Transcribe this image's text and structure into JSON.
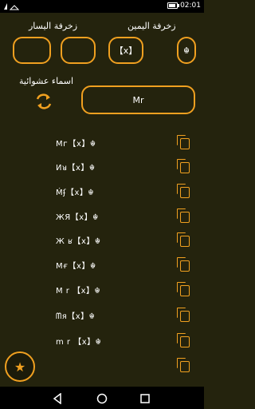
{
  "status": {
    "left_icons": "signal-wifi",
    "battery": "",
    "time": "02:01",
    "battery_level": 0.9
  },
  "header": {
    "right_label": "زخرفة اليمين",
    "left_label": "زخرفة اليسار"
  },
  "decoration_boxes": {
    "right_1": "☬",
    "right_2": "【x】",
    "left_1": "",
    "left_2": ""
  },
  "random_names_label": "اسماء عشوائية",
  "input": {
    "value": "Mr"
  },
  "rows": [
    {
      "text": "Mᴦ【x】☬"
    },
    {
      "text": "Иᴚ【x】☬"
    },
    {
      "text": "Ḿʄ【x】☬"
    },
    {
      "text": "ЖЯ【x】☬"
    },
    {
      "text": "Ж ʁ【x】☬"
    },
    {
      "text": "Mғ【x】☬"
    },
    {
      "text": "M r 【x】☬"
    },
    {
      "text": "ᗰя【x】☬"
    },
    {
      "text": "m r 【x】☬"
    },
    {
      "text": ""
    }
  ],
  "accent_color": "#f0a020",
  "background_color": "#24230d",
  "fab_icon": "star-icon"
}
